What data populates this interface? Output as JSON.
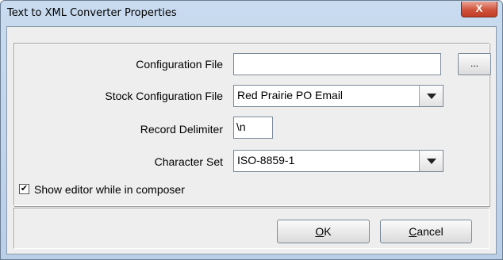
{
  "window": {
    "title": "Text to XML Converter Properties",
    "close_label": "X"
  },
  "fields": {
    "config_file": {
      "label": "Configuration File",
      "value": "",
      "browse_label": "..."
    },
    "stock_config": {
      "label": "Stock Configuration File",
      "value": "Red Prairie PO Email"
    },
    "record_delimiter": {
      "label": "Record Delimiter",
      "value": "\\n"
    },
    "charset": {
      "label": "Character Set",
      "value": "ISO-8859-1"
    }
  },
  "show_editor": {
    "checked": true,
    "check_mark": "✔",
    "label": "Show editor while in composer"
  },
  "buttons": {
    "ok": {
      "mnemonic": "O",
      "rest": "K"
    },
    "cancel": {
      "mnemonic": "C",
      "rest": "ancel"
    }
  }
}
